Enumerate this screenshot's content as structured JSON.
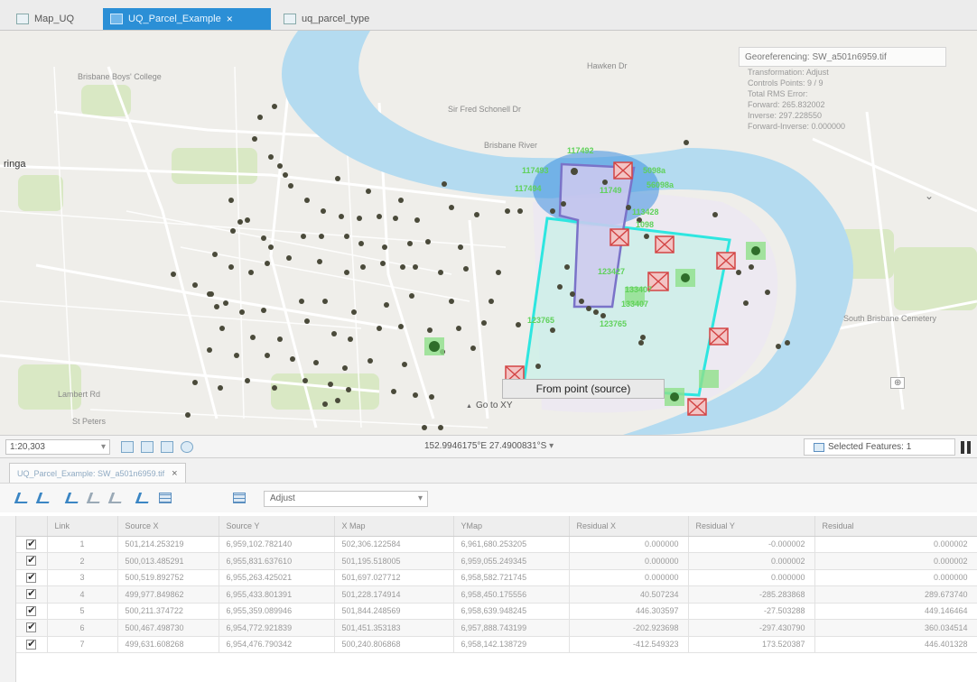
{
  "tabs": [
    {
      "label": "Map_UQ",
      "icon": "map-icon",
      "active": false
    },
    {
      "label": "UQ_Parcel_Example",
      "icon": "map-icon",
      "active": true
    },
    {
      "label": "uq_parcel_type",
      "icon": "table-icon",
      "active": false
    }
  ],
  "tab_close": "×",
  "map_labels": {
    "boys_college": "Brisbane Boys' College",
    "suburb_left": "ringa",
    "river": "Brisbane River",
    "road1": "Hawken Dr",
    "road2": "Sir Fred Schonell Dr",
    "cemetery": "South Brisbane Cemetery",
    "park": "St Peters",
    "rd_bottom": "Lambert Rd"
  },
  "control_point_labels": [
    "117492",
    "117493",
    "117494",
    "11749",
    "5098a",
    "56098a",
    "113428",
    "123427",
    "133407",
    "133407",
    "123765",
    "123765",
    "1098"
  ],
  "georef": {
    "title": "Georeferencing: SW_a501n6959.tif",
    "lines": [
      "Transformation: Adjust",
      "Controls Points: 9 / 9",
      "Total RMS Error:",
      "Forward: 265.832002",
      "Inverse: 297.228550",
      "Forward-Inverse: 0.000000"
    ]
  },
  "callout": {
    "label": "From point (source)",
    "goto": "Go to XY"
  },
  "status": {
    "scale": "1:20,303",
    "coordinates": "152.9946175°E 27.4900831°S",
    "selected_features": "Selected Features: 1"
  },
  "pane_tab": {
    "label": "UQ_Parcel_Example: SW_a501n6959.tif",
    "close": "×"
  },
  "toolbar": {
    "transformation": "Adjust"
  },
  "table": {
    "headers": [
      "",
      "Link",
      "Source X",
      "Source Y",
      "X Map",
      "YMap",
      "Residual X",
      "Residual Y",
      "Residual"
    ],
    "rows": [
      [
        "1",
        "501,214.253219",
        "6,959,102.782140",
        "502,306.122584",
        "6,961,680.253205",
        "0.000000",
        "-0.000002",
        "0.000002"
      ],
      [
        "2",
        "500,013.485291",
        "6,955,831.637610",
        "501,195.518005",
        "6,959,055.249345",
        "0.000000",
        "0.000002",
        "0.000002"
      ],
      [
        "3",
        "500,519.892752",
        "6,955,263.425021",
        "501,697.027712",
        "6,958,582.721745",
        "0.000000",
        "0.000000",
        "0.000000"
      ],
      [
        "4",
        "499,977.849862",
        "6,955,433.801391",
        "501,228.174914",
        "6,958,450.175556",
        "40.507234",
        "-285.283868",
        "289.673740"
      ],
      [
        "5",
        "500,211.374722",
        "6,955,359.089946",
        "501,844.248569",
        "6,958,639.948245",
        "446.303597",
        "-27.503288",
        "449.146464"
      ],
      [
        "6",
        "500,467.498730",
        "6,954,772.921839",
        "501,451.353183",
        "6,957,888.743199",
        "-202.923698",
        "-297.430790",
        "360.034514"
      ],
      [
        "7",
        "499,631.608268",
        "6,954,476.790342",
        "500,240.806868",
        "6,958,142.138729",
        "-412.549323",
        "173.520387",
        "446.401328"
      ]
    ]
  },
  "colors": {
    "accent_tab": "#2b8fd6",
    "river": "#b4dbf0",
    "source_polygon": "#2ee6e0",
    "target_polygon": "#7a73c8",
    "control_point_label": "#5fd15a",
    "point": "#4a4a3a"
  }
}
